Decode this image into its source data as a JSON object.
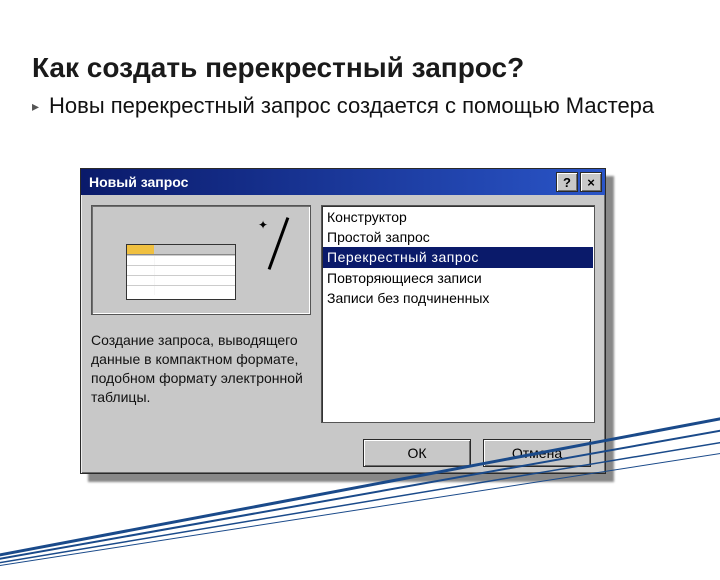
{
  "heading": "Как создать перекрестный запрос?",
  "bullet": {
    "icon": "▸",
    "text": "Новы перекрестный запрос создается с помощью Мастера"
  },
  "dialog": {
    "title": "Новый запрос",
    "help_label": "?",
    "close_label": "×",
    "description": "Создание запроса, выводящего данные в компактном формате, подобном формату электронной таблицы.",
    "list": {
      "items": [
        {
          "label": "Конструктор"
        },
        {
          "label": "Простой запрос"
        },
        {
          "label": "Перекрестный запрос"
        },
        {
          "label": "Повторяющиеся записи"
        },
        {
          "label": "Записи без подчиненных"
        }
      ],
      "selected_index": 2
    },
    "buttons": {
      "ok": "ОК",
      "cancel": "Отмена"
    }
  }
}
